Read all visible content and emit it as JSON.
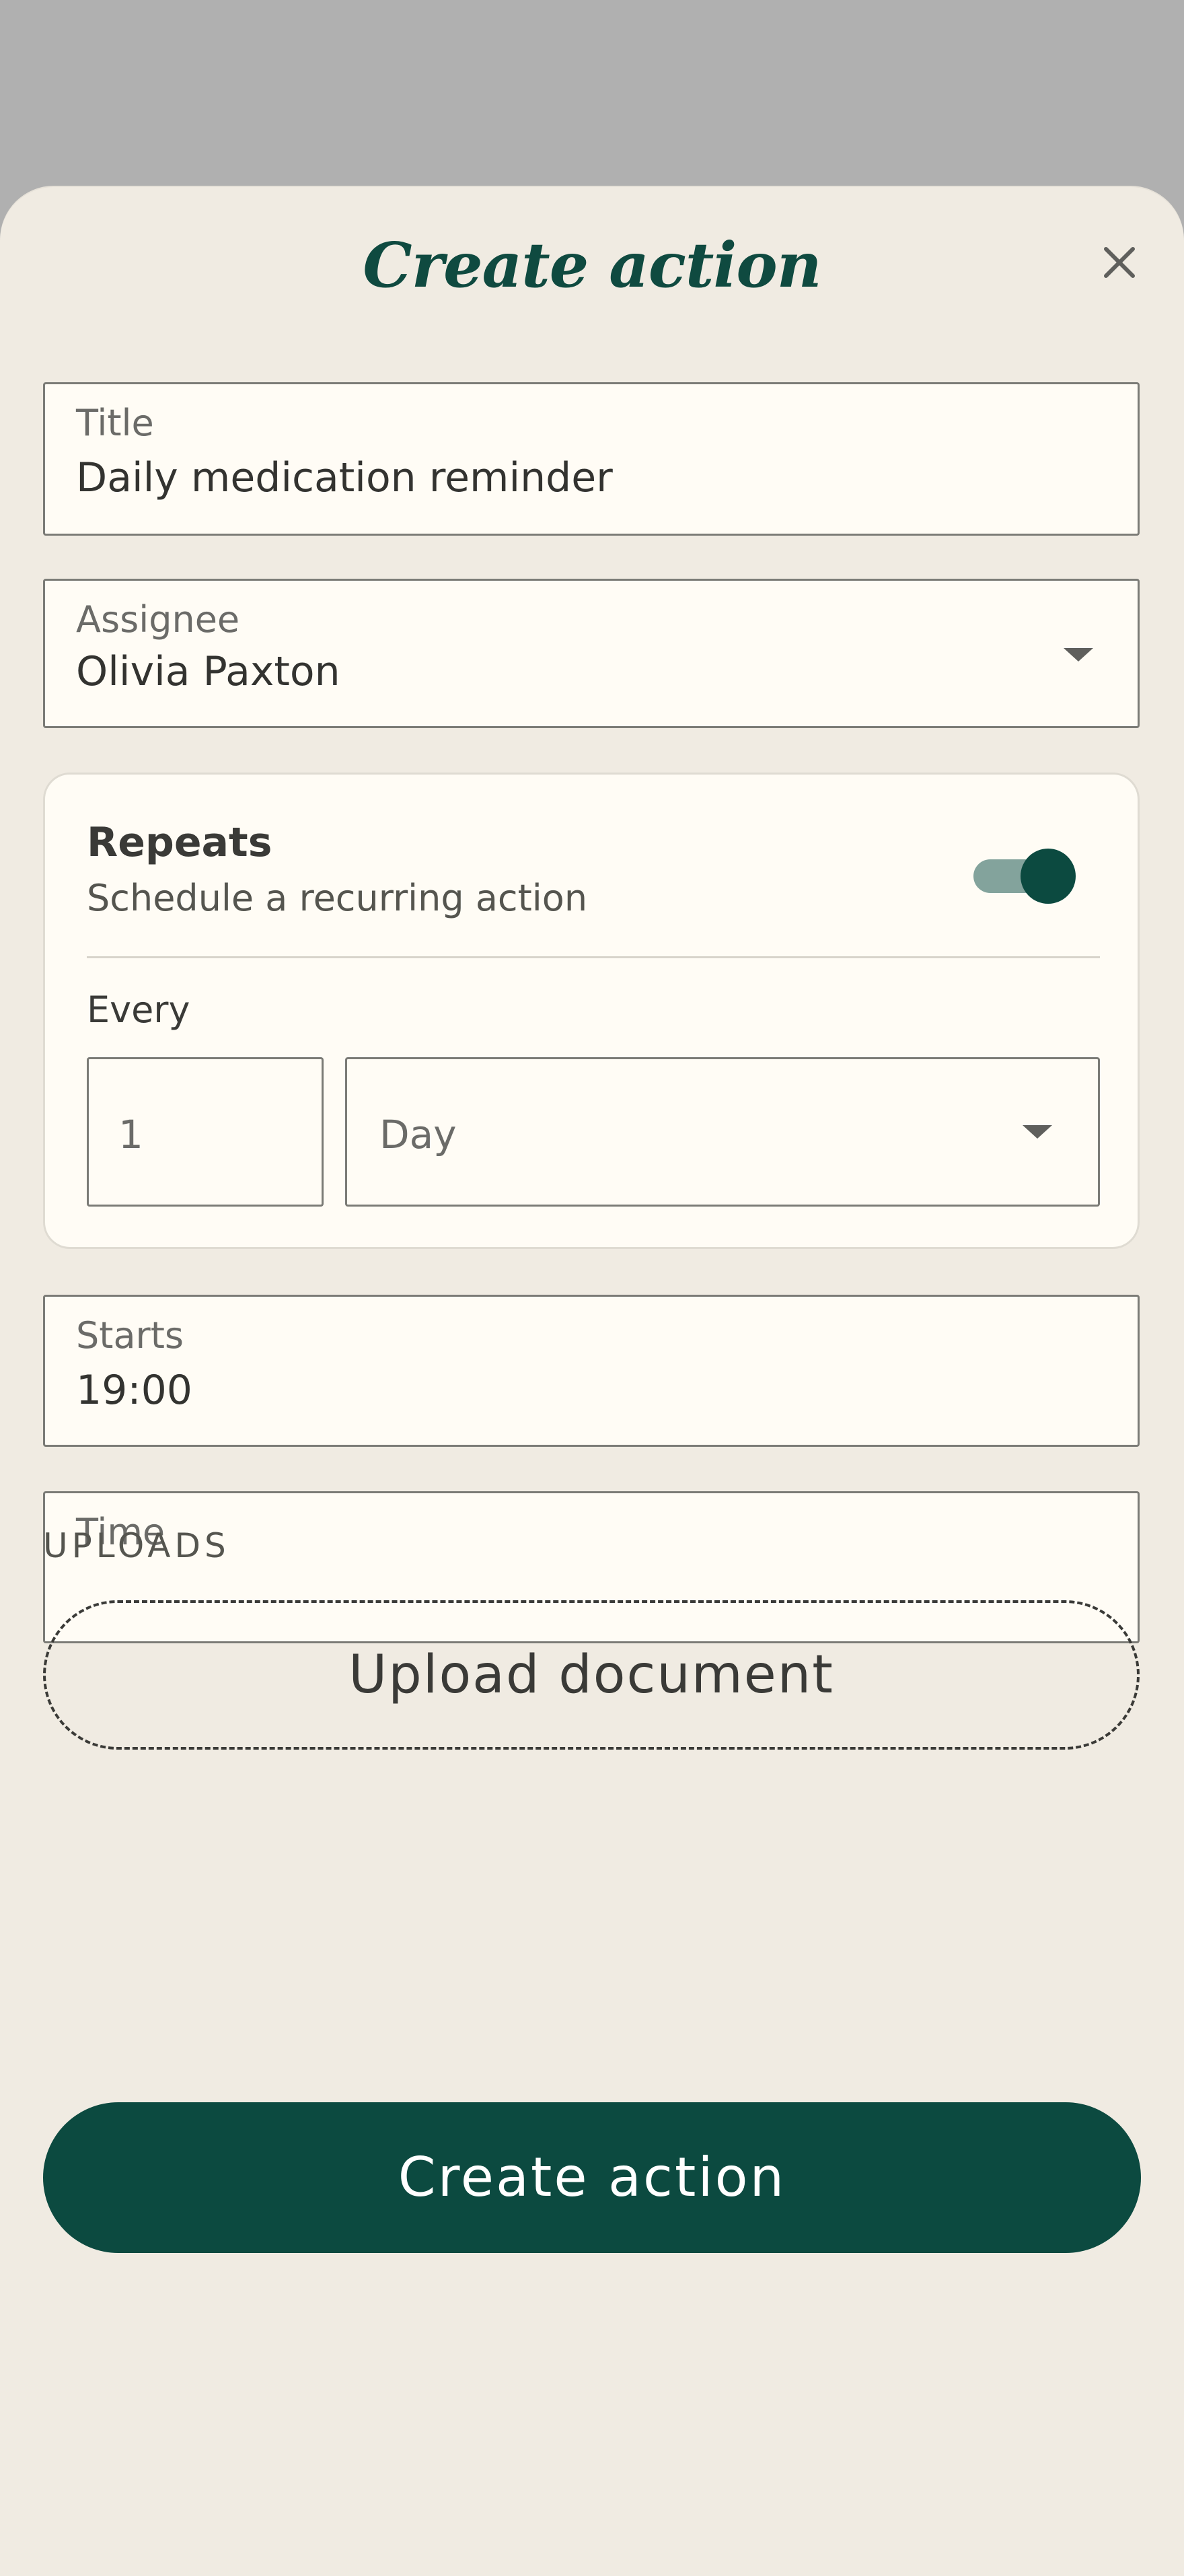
{
  "dialog": {
    "title": "Create action",
    "close_icon": "close-icon"
  },
  "form": {
    "title_field": {
      "label": "Title",
      "value": "Daily medication reminder"
    },
    "assignee_field": {
      "label": "Assignee",
      "value": "Olivia Paxton",
      "icon": "chevron-down-icon"
    },
    "repeats": {
      "title": "Repeats",
      "subtitle": "Schedule a recurring action",
      "toggle_on": true,
      "every_label": "Every",
      "interval_value": "1",
      "unit_value": "Day",
      "unit_icon": "chevron-down-icon"
    },
    "starts_field": {
      "label": "Starts",
      "value": "19:00"
    },
    "time_field": {
      "label": "Time",
      "value": ""
    }
  },
  "uploads": {
    "section_label": "UPLOADS",
    "button_label": "Upload document"
  },
  "footer": {
    "create_button_label": "Create action"
  },
  "colors": {
    "accent": "#0c4a40",
    "sheet_background": "#f0ebe2",
    "field_background": "#fffcf5",
    "overlay": "#b0b0b0"
  }
}
